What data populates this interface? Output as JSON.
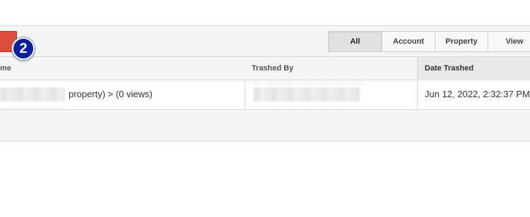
{
  "toolbar": {
    "step_badge": "2",
    "filters": [
      {
        "label": "All",
        "active": true
      },
      {
        "label": "Account",
        "active": false
      },
      {
        "label": "Property",
        "active": false
      },
      {
        "label": "View",
        "active": false
      }
    ]
  },
  "table": {
    "columns": {
      "name": "me",
      "trashed_by": "Trashed By",
      "date_trashed": "Date Trashed"
    },
    "rows": [
      {
        "name_suffix": "property) > (0 views)",
        "date_trashed": "Jun 12, 2022, 2:32:37 PM"
      }
    ]
  },
  "colors": {
    "accent_red": "#dd4b39",
    "badge_blue": "#0b1fa0"
  }
}
